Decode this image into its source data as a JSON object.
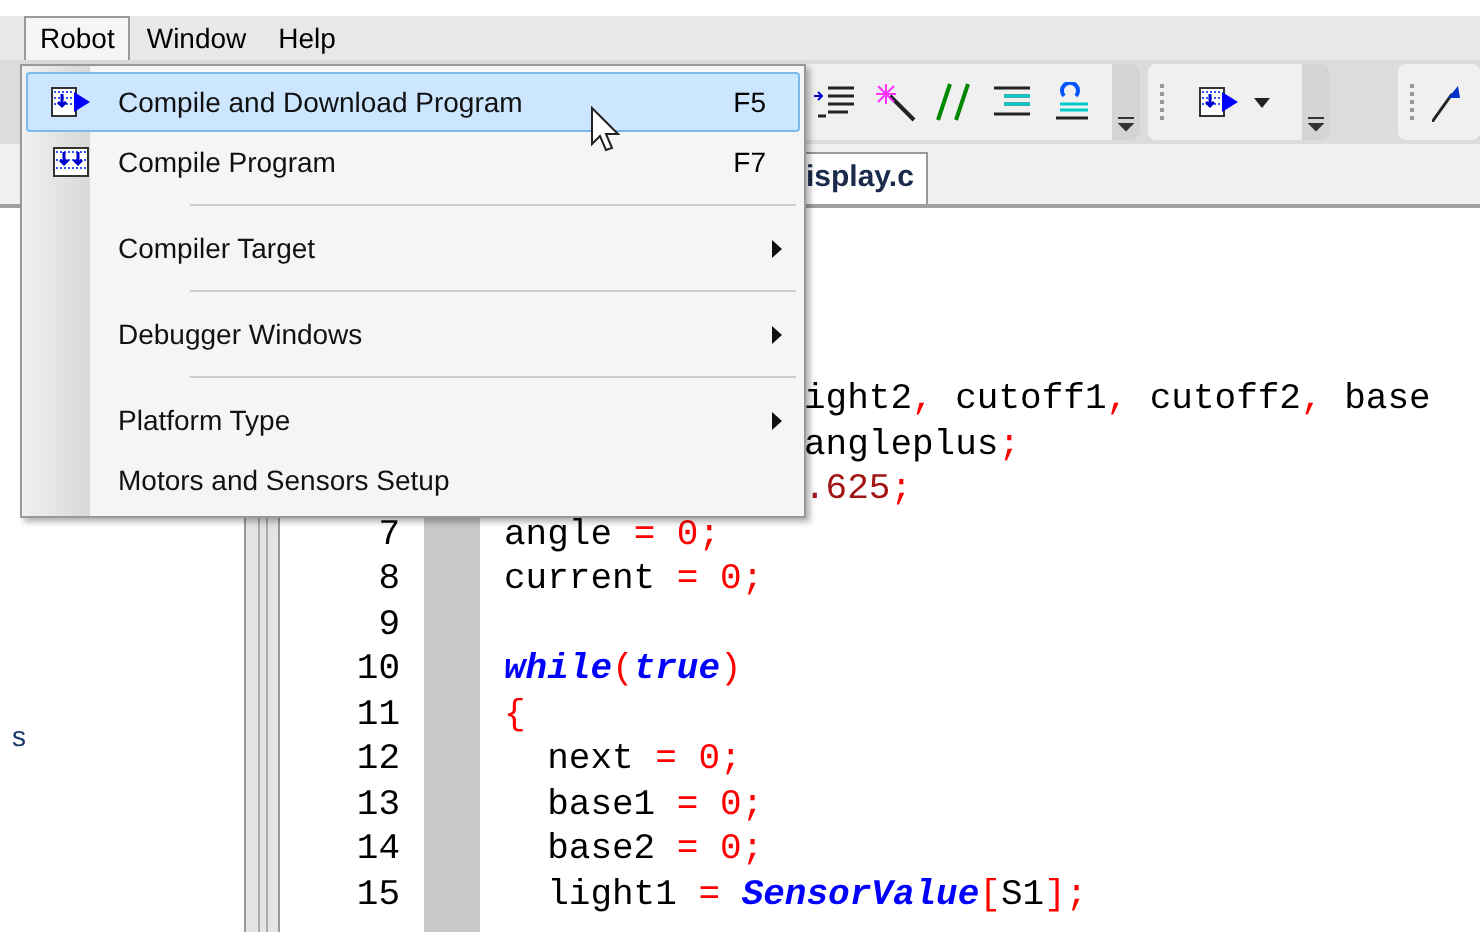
{
  "menubar": [
    {
      "label": "Robot",
      "selected": true
    },
    {
      "label": "Window",
      "selected": false
    },
    {
      "label": "Help",
      "selected": false
    }
  ],
  "menu": [
    {
      "kind": "item",
      "label": "Compile and Download Program",
      "shortcut": "F5",
      "selected": true,
      "submenu": false
    },
    {
      "kind": "item",
      "label": "Compile Program",
      "shortcut": "F7",
      "selected": false,
      "submenu": false
    },
    {
      "kind": "separator"
    },
    {
      "kind": "item",
      "label": "Compiler Target",
      "selected": false,
      "submenu": true
    },
    {
      "kind": "separator"
    },
    {
      "kind": "item",
      "label": "Debugger Windows",
      "selected": false,
      "submenu": true
    },
    {
      "kind": "separator"
    },
    {
      "kind": "item",
      "label": "Platform Type",
      "selected": false,
      "submenu": true
    },
    {
      "kind": "item",
      "label": "Motors and Sensors Setup",
      "selected": false,
      "submenu": false
    }
  ],
  "tab": {
    "label": "isplay.c",
    "selected": true
  },
  "side_panel": {
    "text": "s"
  },
  "code_fragments_beside_menu": [
    [
      {
        "t": "ight2",
        "kind": "plain"
      },
      {
        "t": ",",
        "kind": "op"
      },
      {
        "t": " cutoff1",
        "kind": "plain"
      },
      {
        "t": ",",
        "kind": "op"
      },
      {
        "t": " cutoff2",
        "kind": "plain"
      },
      {
        "t": ",",
        "kind": "op"
      },
      {
        "t": " base",
        "kind": "plain"
      }
    ],
    [
      {
        "t": "angleplus",
        "kind": "plain"
      },
      {
        "t": ";",
        "kind": "op"
      }
    ],
    [
      {
        "t": ".625",
        "kind": "num"
      },
      {
        "t": ";",
        "kind": "op"
      }
    ]
  ],
  "code": [
    {
      "number": "7",
      "tokens": [
        {
          "t": "angle ",
          "kind": "plain"
        },
        {
          "t": "= 0;",
          "kind": "op"
        }
      ]
    },
    {
      "number": "8",
      "tokens": [
        {
          "t": "current ",
          "kind": "plain"
        },
        {
          "t": "= 0;",
          "kind": "op"
        }
      ]
    },
    {
      "number": "9"
    },
    {
      "number": "10",
      "tokens": [
        {
          "t": "while",
          "kind": "kw"
        },
        {
          "t": "(",
          "kind": "op"
        },
        {
          "t": "true",
          "kind": "kw"
        },
        {
          "t": ")",
          "kind": "op"
        }
      ]
    },
    {
      "number": "11",
      "tokens": [
        {
          "t": "{",
          "kind": "op"
        }
      ]
    },
    {
      "number": "12",
      "tokens": [
        {
          "t": "  next ",
          "kind": "plain"
        },
        {
          "t": "= 0;",
          "kind": "op"
        }
      ]
    },
    {
      "number": "13",
      "tokens": [
        {
          "t": "  base1 ",
          "kind": "plain"
        },
        {
          "t": "= 0;",
          "kind": "op"
        }
      ]
    },
    {
      "number": "14",
      "tokens": [
        {
          "t": "  base2 ",
          "kind": "plain"
        },
        {
          "t": "= 0;",
          "kind": "op"
        }
      ]
    },
    {
      "number": "15",
      "tokens": [
        {
          "t": "  light1 ",
          "kind": "plain"
        },
        {
          "t": "= ",
          "kind": "op"
        },
        {
          "t": "SensorValue",
          "kind": "kw"
        },
        {
          "t": "[",
          "kind": "op"
        },
        {
          "t": "S1",
          "kind": "plain"
        },
        {
          "t": "];",
          "kind": "op"
        }
      ]
    }
  ]
}
